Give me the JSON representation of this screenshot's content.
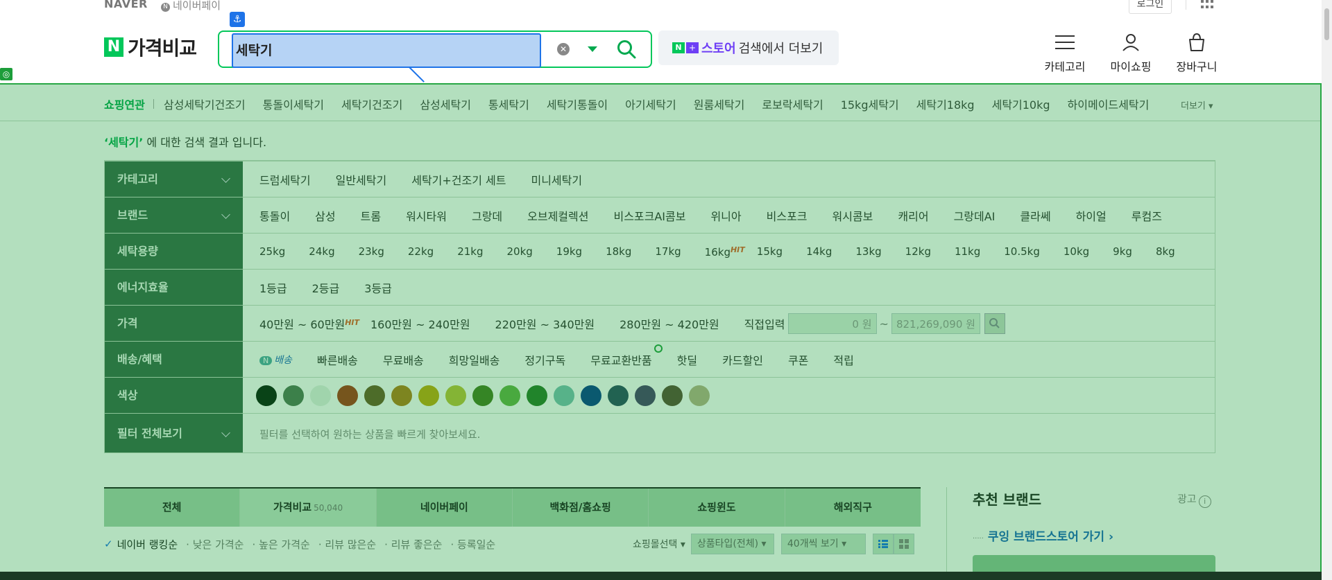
{
  "topbar": {
    "naver": "NAVER",
    "npay": "네이버페이",
    "login": "로그인"
  },
  "header": {
    "brand_n": "N",
    "brand_text": "가격비교",
    "search_value": "세탁기",
    "clear_glyph": "✕",
    "store_n": "N",
    "store_plus": "+",
    "store_name": "스토어",
    "store_text": "검색에서 더보기",
    "icons": [
      {
        "label": "카테고리",
        "icon": "menu-icon"
      },
      {
        "label": "마이쇼핑",
        "icon": "user-icon"
      },
      {
        "label": "장바구니",
        "icon": "cart-icon"
      }
    ]
  },
  "related": {
    "title": "쇼핑연관",
    "items": [
      "삼성세탁기건조기",
      "통돌이세탁기",
      "세탁기건조기",
      "삼성세탁기",
      "통세탁기",
      "세탁기통돌이",
      "아기세탁기",
      "원룸세탁기",
      "로보락세탁기",
      "15kg세탁기",
      "세탁기18kg",
      "세탁기10kg",
      "하이메이드세탁기"
    ],
    "more": "더보기"
  },
  "result": {
    "keyword": "‘세탁기’",
    "suffix": " 에 대한 검색 결과 입니다."
  },
  "filters": {
    "category": {
      "label": "카테고리",
      "items": [
        "드럼세탁기",
        "일반세탁기",
        "세탁기+건조기 세트",
        "미니세탁기"
      ]
    },
    "brand": {
      "label": "브랜드",
      "items": [
        "통돌이",
        "삼성",
        "트롬",
        "워시타워",
        "그랑데",
        "오브제컬렉션",
        "비스포크AI콤보",
        "위니아",
        "비스포크",
        "워시콤보",
        "캐리어",
        "그랑데AI",
        "클라쎄",
        "하이얼",
        "루컴즈"
      ]
    },
    "capacity": {
      "label": "세탁용량",
      "items": [
        "25kg",
        "24kg",
        "23kg",
        "22kg",
        "21kg",
        "20kg",
        "19kg",
        "18kg",
        "17kg",
        "16kg",
        "15kg",
        "14kg",
        "13kg",
        "12kg",
        "11kg",
        "10.5kg",
        "10kg",
        "9kg",
        "8kg"
      ],
      "hit_index": 9
    },
    "energy": {
      "label": "에너지효율",
      "items": [
        "1등급",
        "2등급",
        "3등급"
      ]
    },
    "price": {
      "label": "가격",
      "items": [
        "40만원 ~ 60만원",
        "160만원 ~ 240만원",
        "220만원 ~ 340만원",
        "280만원 ~ 420만원"
      ],
      "direct": "직접입력",
      "min": "0 원",
      "tilde": "~",
      "max": "821,269,090 원"
    },
    "delivery": {
      "label": "배송/혜택",
      "nbadge": "N",
      "nbadge_text": "배송",
      "items": [
        "빠른배송",
        "무료배송",
        "희망일배송",
        "정기구독",
        "무료교환반품",
        "핫딜",
        "카드할인",
        "쿠폰",
        "적립"
      ]
    },
    "color": {
      "label": "색상",
      "swatches": [
        "#0c2010",
        "#55785a",
        "#e4f0e6",
        "#a83a19",
        "#6e5b2a",
        "#b27e1e",
        "#c1a912",
        "#bcc23c",
        "#4b7f24",
        "#68b24a",
        "#2e7d2d",
        "#7bbfb4",
        "#0e3f8f",
        "#2e4d63",
        "#4d3f6e",
        "#5e4e39",
        "#b8b08a"
      ]
    },
    "all": {
      "label": "필터 전체보기",
      "note": "필터를 선택하여 원하는 상품을 빠르게 찾아보세요."
    },
    "hit_label": "HIT"
  },
  "tabs": [
    {
      "label": "전체",
      "count": ""
    },
    {
      "label": "가격비교",
      "count": "50,040"
    },
    {
      "label": "네이버페이",
      "count": ""
    },
    {
      "label": "백화점/홈쇼핑",
      "count": ""
    },
    {
      "label": "쇼핑윈도",
      "count": ""
    },
    {
      "label": "해외직구",
      "count": ""
    }
  ],
  "sort": {
    "check": "✓",
    "items": [
      "네이버 랭킹순",
      "낮은 가격순",
      "높은 가격순",
      "리뷰 많은순",
      "리뷰 좋은순",
      "등록일순"
    ]
  },
  "controls": {
    "mall": "쇼핑몰선택",
    "type": "상품타입(전체)",
    "perpage": "40개씩 보기"
  },
  "side": {
    "title": "추천 브랜드",
    "ad": "광고",
    "ad_info": "i",
    "brand_link": "쿠잉 브랜드스토어 가기"
  },
  "colors": {
    "naver_green": "#03c75a",
    "store_purple": "#6e3ff5",
    "selection_blue": "#1e73e8"
  }
}
